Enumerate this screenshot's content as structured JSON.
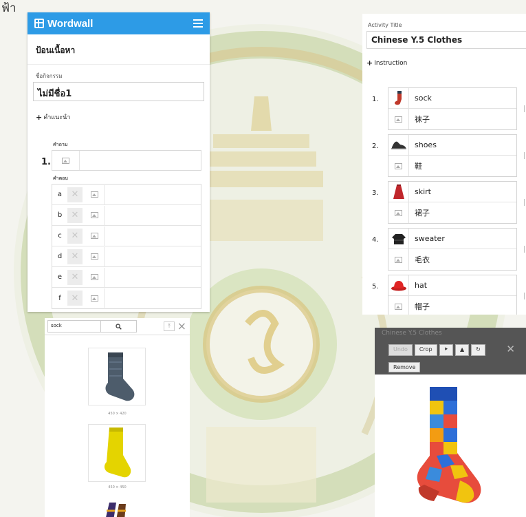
{
  "corner_text": "ฟ้า",
  "editor_th": {
    "brand": "Wordwall",
    "heading": "ป้อนเนื้อหา",
    "title_label": "ชื่อกิจกรรม",
    "title_value": "ไม่มีชื่อ1",
    "instruction_label": "คำแนะนำ",
    "question_label": "คำถาม",
    "answers_label": "คำตอบ",
    "question_number": "1.",
    "answer_letters": [
      "a",
      "b",
      "c",
      "d",
      "e",
      "f"
    ]
  },
  "activity": {
    "title_label": "Activity Title",
    "title_value": "Chinese Y.5 Clothes",
    "instruction_label": "Instruction",
    "items": [
      {
        "num": "1.",
        "word": "sock",
        "translation": "袜子",
        "icon": "sock-icon"
      },
      {
        "num": "2.",
        "word": "shoes",
        "translation": "鞋",
        "icon": "shoes-icon"
      },
      {
        "num": "3.",
        "word": "skirt",
        "translation": "裙子",
        "icon": "skirt-icon"
      },
      {
        "num": "4.",
        "word": "sweater",
        "translation": "毛衣",
        "icon": "sweater-icon"
      },
      {
        "num": "5.",
        "word": "hat",
        "translation": "帽子",
        "icon": "hat-icon"
      }
    ]
  },
  "image_search": {
    "query": "sock",
    "results": [
      {
        "caption": "450 × 420"
      },
      {
        "caption": "450 × 450"
      }
    ]
  },
  "crop_dialog": {
    "title": "Chinese Y.5 Clothes",
    "tools": [
      "Undo",
      "Crop",
      "Remove"
    ]
  }
}
